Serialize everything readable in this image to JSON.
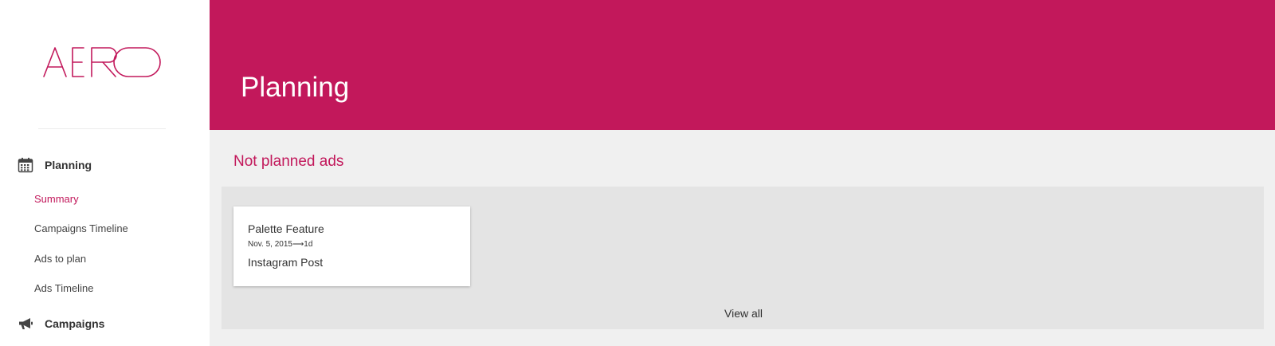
{
  "brand": {
    "logo_text": "AERO"
  },
  "sidebar": {
    "sections": [
      {
        "label": "Planning",
        "icon": "calendar-icon"
      },
      {
        "label": "Campaigns",
        "icon": "megaphone-icon"
      }
    ],
    "planning_items": [
      {
        "label": "Summary",
        "active": true
      },
      {
        "label": "Campaigns Timeline",
        "active": false
      },
      {
        "label": "Ads to plan",
        "active": false
      },
      {
        "label": "Ads Timeline",
        "active": false
      }
    ]
  },
  "header": {
    "title": "Planning"
  },
  "main": {
    "section_title": "Not planned ads",
    "cards": [
      {
        "title": "Palette Feature",
        "meta": "Nov. 5, 2015⟶1d",
        "type": "Instagram Post"
      }
    ],
    "view_all_label": "View all"
  },
  "colors": {
    "accent": "#c2185b",
    "background": "#f0f0f0",
    "panel": "#e4e4e4"
  }
}
